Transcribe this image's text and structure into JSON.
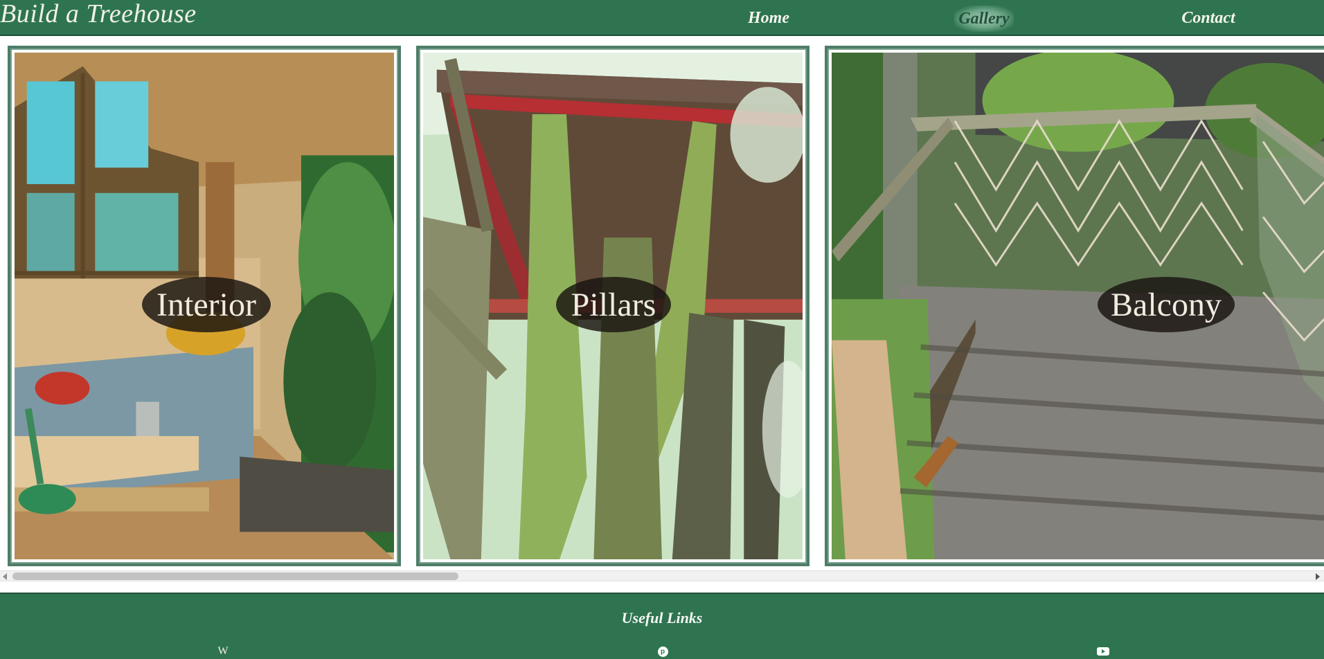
{
  "header": {
    "site_title": "Build a Treehouse",
    "nav": [
      {
        "label": "Home"
      },
      {
        "label": "Gallery"
      },
      {
        "label": "Contact"
      }
    ],
    "active_nav": "Gallery"
  },
  "gallery": {
    "items": [
      {
        "caption": "Interior",
        "image": "treehouse interior with windows, bed and desk lamp"
      },
      {
        "caption": "Pillars",
        "image": "tree trunks supporting the treehouse floor"
      },
      {
        "caption": "Balcony",
        "image": "wooden deck balcony with rope netting railing"
      }
    ]
  },
  "scrollbar": {
    "orientation": "horizontal",
    "position_fraction": 0.0
  },
  "footer": {
    "title": "Useful Links",
    "links": [
      {
        "icon": "wikipedia-icon",
        "glyph": "W"
      },
      {
        "icon": "pinterest-icon",
        "glyph": "p"
      },
      {
        "icon": "youtube-icon",
        "glyph": ""
      }
    ]
  },
  "colors": {
    "brand_green": "#2f7451",
    "frame_green": "#4e7d67",
    "label_bg": "#181410",
    "label_text": "#f2ece0"
  }
}
